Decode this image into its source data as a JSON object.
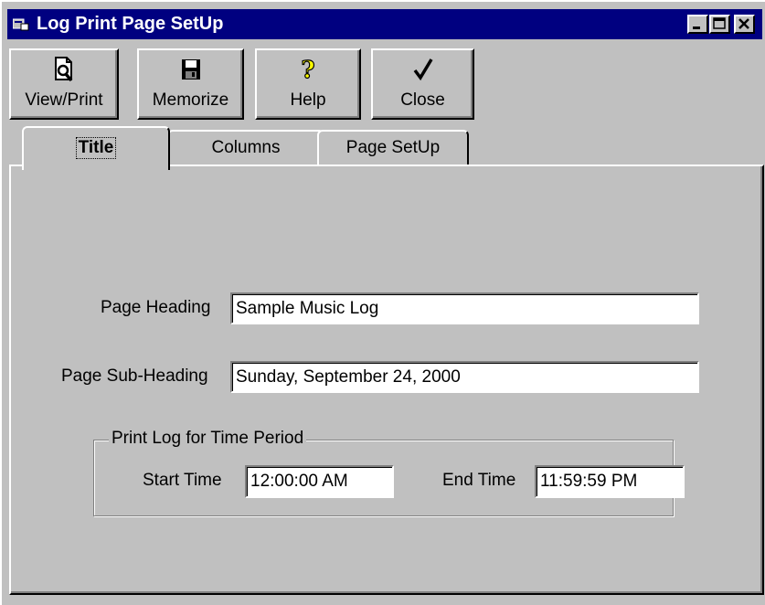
{
  "window": {
    "title": "Log Print Page SetUp",
    "controls": [
      "minimize",
      "maximize",
      "close"
    ]
  },
  "toolbar": {
    "view_print_label": "View/Print",
    "memorize_label": "Memorize",
    "help_label": "Help",
    "close_label": "Close"
  },
  "tabs": {
    "title": "Title",
    "columns": "Columns",
    "page_setup": "Page SetUp",
    "active": "Title"
  },
  "form": {
    "page_heading_label": "Page Heading",
    "page_heading_value": "Sample Music Log",
    "page_subheading_label": "Page Sub-Heading",
    "page_subheading_value": "Sunday, September 24, 2000",
    "group_title": "Print Log for Time Period",
    "start_time_label": "Start Time",
    "start_time_value": "12:00:00 AM",
    "end_time_label": "End Time",
    "end_time_value": "11:59:59 PM"
  },
  "colors": {
    "titlebar": "#000080",
    "face": "#c0c0c0"
  },
  "icons": {
    "view_print": "print-preview-icon",
    "memorize": "floppy-disk-icon",
    "help": "question-mark-icon",
    "close": "checkmark-icon"
  }
}
